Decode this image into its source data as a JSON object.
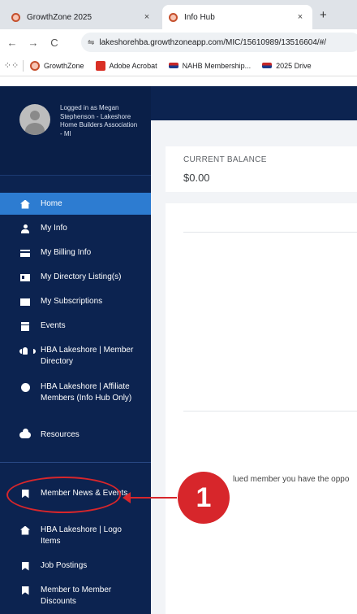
{
  "browser": {
    "tabs": [
      {
        "title": "GrowthZone 2025",
        "close": "×",
        "active": false
      },
      {
        "title": "Info Hub",
        "close": "×",
        "active": true
      }
    ],
    "new_tab": "+",
    "nav": {
      "back": "←",
      "forward": "→",
      "reload": "C"
    },
    "url": "lakeshorehba.growthzoneapp.com/MIC/15610989/13516604/#/",
    "bookmarks": [
      {
        "label": "GrowthZone",
        "icon": "growthzone-icon"
      },
      {
        "label": "Adobe Acrobat",
        "icon": "acrobat-icon"
      },
      {
        "label": "NAHB Membership...",
        "icon": "nahb-icon"
      },
      {
        "label": "2025 Drive",
        "icon": "nahb-icon"
      }
    ]
  },
  "sidebar": {
    "profile_text": "Logged in as Megan Stephenson - Lakeshore Home Builders Association - MI",
    "items": [
      {
        "label": "Home",
        "icon": "home-icon",
        "active": true
      },
      {
        "label": "My Info",
        "icon": "user-icon"
      },
      {
        "label": "My Billing Info",
        "icon": "credit-card-icon"
      },
      {
        "label": "My Directory Listing(s)",
        "icon": "id-card-icon"
      },
      {
        "label": "My Subscriptions",
        "icon": "envelope-icon"
      },
      {
        "label": "Events",
        "icon": "calendar-icon"
      },
      {
        "label": "HBA Lakeshore | Member Directory",
        "icon": "users-icon"
      },
      {
        "label": "HBA Lakeshore | Affiliate Members (Info Hub Only)",
        "icon": "circle-icon"
      },
      {
        "label": "Resources",
        "icon": "cloud-icon"
      },
      {
        "label": "Member News & Events",
        "icon": "bookmark-icon"
      },
      {
        "label": "HBA Lakeshore | Logo Items",
        "icon": "house-icon"
      },
      {
        "label": "Job Postings",
        "icon": "bookmark-icon"
      },
      {
        "label": "Member to Member Discounts",
        "icon": "bookmark-icon"
      }
    ]
  },
  "main": {
    "balance_label": "CURRENT BALANCE",
    "balance_value": "$0.00",
    "partial_text": "lued member you have the oppo"
  },
  "annotation": {
    "step": "1",
    "color": "#d7262b"
  },
  "colors": {
    "sidebar_bg": "#0c2350",
    "active_item": "#2d7cd1"
  }
}
